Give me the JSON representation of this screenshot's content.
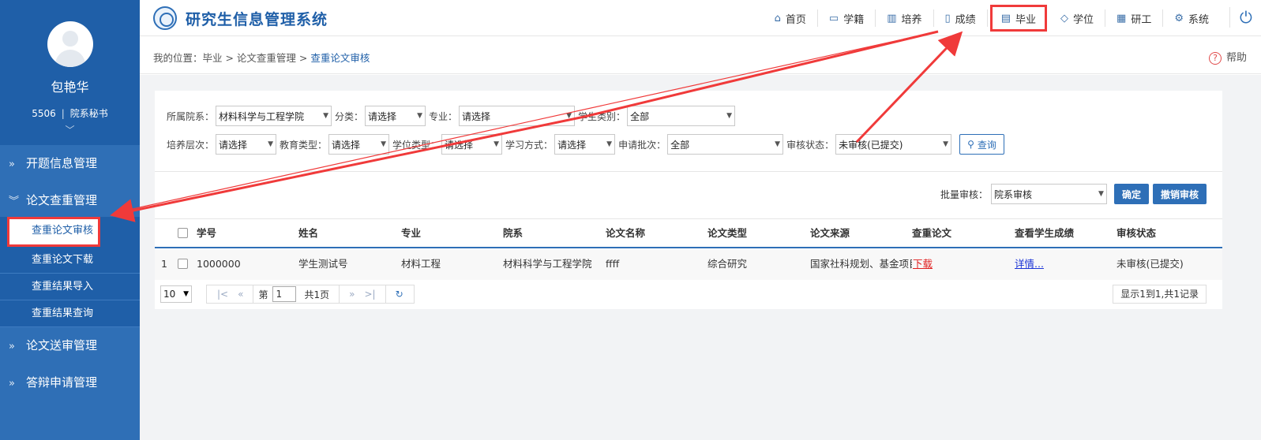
{
  "app": {
    "title": "研究生信息管理系统"
  },
  "user": {
    "name": "包艳华",
    "id": "5506",
    "role": "院系秘书"
  },
  "nav": {
    "items": [
      {
        "label": "首页",
        "icon": "home-icon"
      },
      {
        "label": "学籍",
        "icon": "id-card-icon"
      },
      {
        "label": "培养",
        "icon": "chart-icon"
      },
      {
        "label": "成绩",
        "icon": "document-icon"
      },
      {
        "label": "毕业",
        "icon": "certificate-icon"
      },
      {
        "label": "学位",
        "icon": "graduation-cap-icon"
      },
      {
        "label": "研工",
        "icon": "grid-icon"
      },
      {
        "label": "系统",
        "icon": "gear-icon"
      }
    ],
    "active": "毕业"
  },
  "sidebar": {
    "groups": [
      {
        "label": "开题信息管理"
      },
      {
        "label": "论文查重管理",
        "items": [
          "查重论文审核",
          "查重论文下载",
          "查重结果导入",
          "查重结果查询"
        ]
      },
      {
        "label": "论文送审管理"
      },
      {
        "label": "答辩申请管理"
      }
    ]
  },
  "breadcrumb": {
    "prefix": "我的位置：",
    "path": "毕业 > 论文查重管理 > ",
    "current": "查重论文审核"
  },
  "help": {
    "label": "帮助"
  },
  "filters": {
    "department": {
      "label": "所属院系：",
      "value": "材料科学与工程学院"
    },
    "category": {
      "label": "分类：",
      "value": "请选择"
    },
    "major": {
      "label": "专业：",
      "value": "请选择"
    },
    "student_type": {
      "label": "学生类别：",
      "value": "全部"
    },
    "level": {
      "label": "培养层次：",
      "value": "请选择"
    },
    "edu_type": {
      "label": "教育类型：",
      "value": "请选择"
    },
    "degree_type": {
      "label": "学位类型：",
      "value": "请选择"
    },
    "study_mode": {
      "label": "学习方式：",
      "value": "请选择"
    },
    "batch": {
      "label": "申请批次：",
      "value": "全部"
    },
    "review_status": {
      "label": "审核状态：",
      "value": "未审核(已提交)"
    },
    "query_button": "查询"
  },
  "batch_review": {
    "label": "批量审核：",
    "value": "院系审核",
    "confirm": "确定",
    "revoke": "撤销审核"
  },
  "table": {
    "headers": [
      "学号",
      "姓名",
      "专业",
      "院系",
      "论文名称",
      "论文类型",
      "论文来源",
      "查重论文",
      "查看学生成绩",
      "审核状态"
    ],
    "rows": [
      {
        "index": "1",
        "student_id": "1000000",
        "name": "学生测试号",
        "major": "材料工程",
        "dept": "材料科学与工程学院",
        "title": "ffff",
        "type": "综合研究",
        "source": "国家社科规划、基金项目",
        "download": "下载",
        "grades": "详情...",
        "status": "未审核(已提交)"
      }
    ]
  },
  "pager": {
    "page_size": "10",
    "page_label": "第",
    "page": "1",
    "total_pages": "共1页",
    "summary": "显示1到1,共1记录"
  }
}
